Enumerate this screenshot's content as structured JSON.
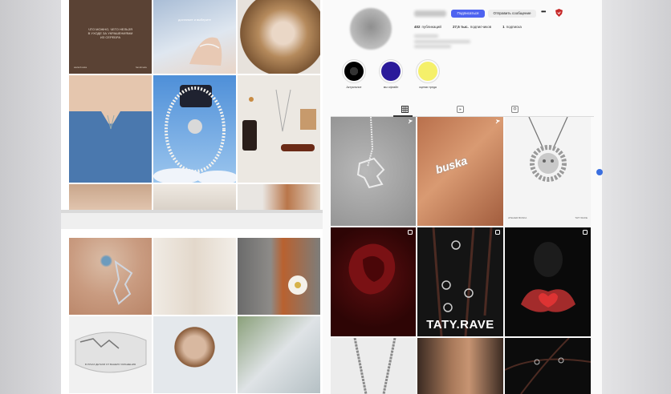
{
  "profile": {
    "follow_label": "Подписаться",
    "message_label": "Отправить сообщение",
    "more_label": "•••",
    "stats": [
      {
        "value": "402",
        "label": "публикаций"
      },
      {
        "value": "27,5 тыс.",
        "label": "подписчиков"
      },
      {
        "value": "1",
        "label": "подписка"
      }
    ],
    "accent_color": "#4e63f0"
  },
  "highlights": [
    {
      "label": "Актуальное",
      "color": "#111111"
    },
    {
      "label": "мы офлайн",
      "color": "#2a1a9a"
    },
    {
      "label": "оценки треда",
      "color": "#f5f06a"
    }
  ],
  "tabs": [
    {
      "icon": "grid-icon"
    },
    {
      "icon": "reels-icon"
    },
    {
      "icon": "tagged-icon"
    }
  ],
  "posts": {
    "rave_title": "TATY.RAVE",
    "buska_text": "buska",
    "sun_caption_left": "ATELIER BUSKA",
    "sun_caption_right": "TATY.RAVE"
  },
  "left_screens": {
    "brown_tile_lines": [
      "ЧТО МОЖНО, ЧЕГО НЕЛЬЗЯ",
      "В УХОДЕ ЗА УКРАШЕНИЯМИ",
      "ИЗ СЕРЕБРА"
    ],
    "brown_tile_footer_left": "atelierbuska",
    "brown_tile_footer_right": "handmade",
    "blue_tile_text": "достаньте и выберите",
    "ring_tile_text": "В РУКАХ ДЕТАЛИ ОТ ВАШЕГО УКРАШЕНИЯ"
  }
}
